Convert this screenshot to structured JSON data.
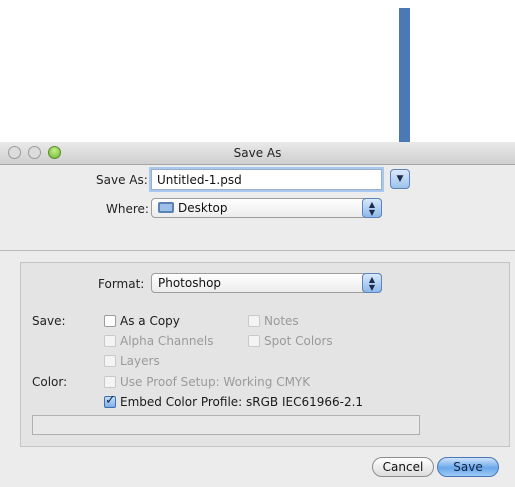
{
  "window": {
    "title": "Save As"
  },
  "save_as": {
    "label": "Save As:",
    "value": "Untitled-1.psd"
  },
  "where": {
    "label": "Where:",
    "value": "Desktop"
  },
  "format": {
    "label": "Format:",
    "value": "Photoshop"
  },
  "save_options": {
    "label": "Save:",
    "as_a_copy": "As a Copy",
    "notes": "Notes",
    "alpha_channels": "Alpha Channels",
    "spot_colors": "Spot Colors",
    "layers": "Layers"
  },
  "color_options": {
    "label": "Color:",
    "use_proof_setup": "Use Proof Setup:  Working CMYK",
    "embed_color_profile": "Embed Color Profile:  sRGB IEC61966-2.1",
    "embed_checked": true
  },
  "buttons": {
    "cancel": "Cancel",
    "save": "Save"
  },
  "icons": {
    "expand": "chevron-down-icon",
    "where_folder": "desktop-folder-icon",
    "popup_arrows": "updown-arrows-icon",
    "annotation": "down-arrow-icon"
  },
  "colors": {
    "annotation_arrow": "#4a79b5",
    "accent": "#6aa7ea"
  }
}
